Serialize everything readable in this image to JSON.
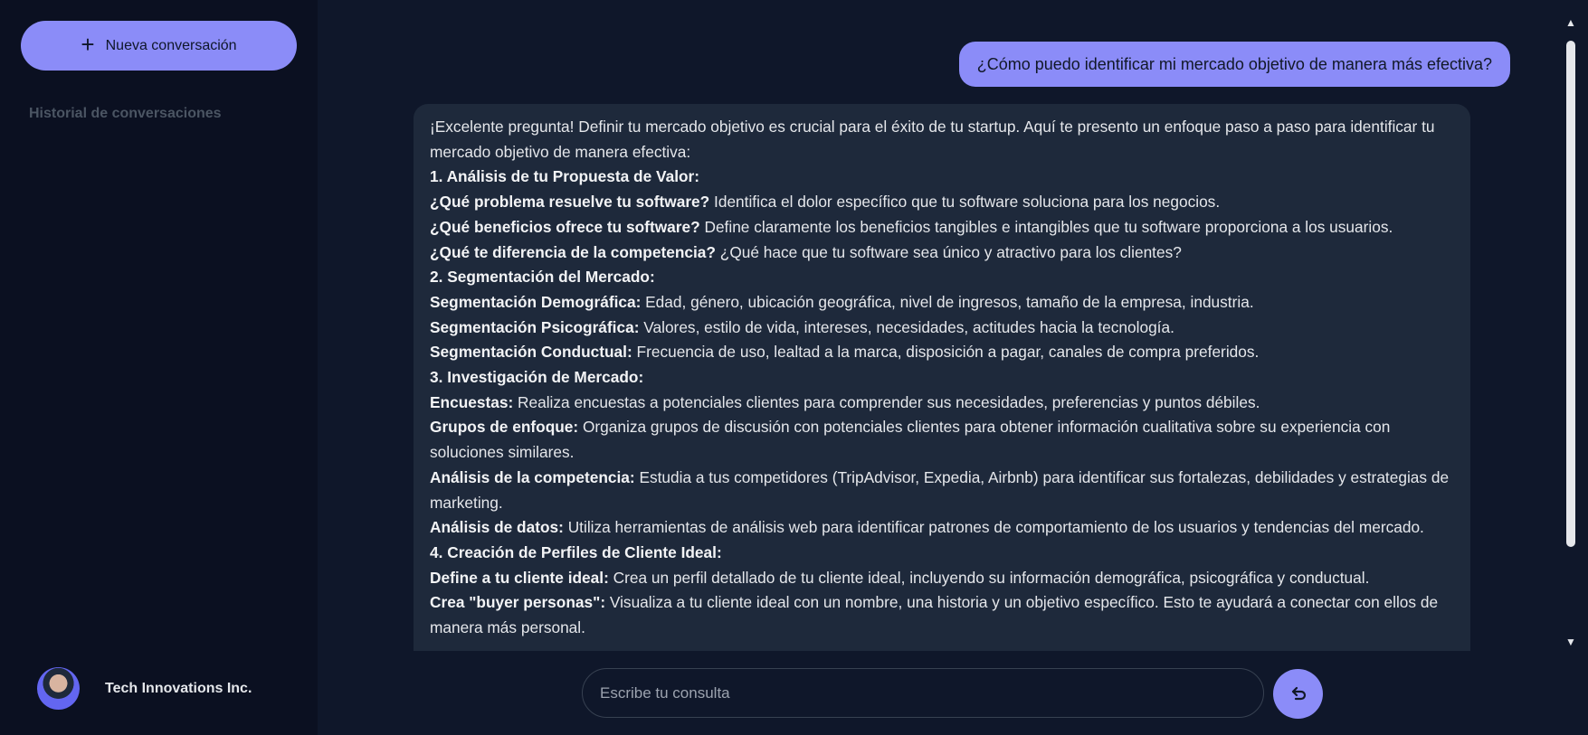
{
  "sidebar": {
    "new_chat_label": "Nueva conversación",
    "new_chat_icon": "plus-icon",
    "history_title": "Historial de conversaciones",
    "profile": {
      "name": "Tech Innovations Inc."
    }
  },
  "chat": {
    "user_message": "¿Cómo puedo identificar mi mercado objetivo de manera más efectiva?",
    "assistant_message": {
      "intro": "¡Excelente pregunta! Definir tu mercado objetivo es crucial para el éxito de tu startup. Aquí te presento un enfoque paso a paso para identificar tu mercado objetivo de manera efectiva:",
      "h1": "1. Análisis de tu Propuesta de Valor:",
      "p1_b": "¿Qué problema resuelve tu software?",
      "p1_t": " Identifica el dolor específico que tu software soluciona para los negocios.",
      "p2_b": "¿Qué beneficios ofrece tu software?",
      "p2_t": " Define claramente los beneficios tangibles e intangibles que tu software proporciona a los usuarios.",
      "p3_b": "¿Qué te diferencia de la competencia?",
      "p3_t": " ¿Qué hace que tu software sea único y atractivo para los clientes?",
      "h2": "2. Segmentación del Mercado:",
      "p4_b": "Segmentación Demográfica:",
      "p4_t": " Edad, género, ubicación geográfica, nivel de ingresos, tamaño de la empresa, industria.",
      "p5_b": "Segmentación Psicográfica:",
      "p5_t": " Valores, estilo de vida, intereses, necesidades, actitudes hacia la tecnología.",
      "p6_b": "Segmentación Conductual:",
      "p6_t": " Frecuencia de uso, lealtad a la marca, disposición a pagar, canales de compra preferidos.",
      "h3": "3. Investigación de Mercado:",
      "p7_b": "Encuestas:",
      "p7_t": " Realiza encuestas a potenciales clientes para comprender sus necesidades, preferencias y puntos débiles.",
      "p8_b": "Grupos de enfoque:",
      "p8_t": " Organiza grupos de discusión con potenciales clientes para obtener información cualitativa sobre su experiencia con soluciones similares.",
      "p9_b": "Análisis de la competencia:",
      "p9_t": " Estudia a tus competidores (TripAdvisor, Expedia, Airbnb) para identificar sus fortalezas, debilidades y estrategias de marketing.",
      "p10_b": "Análisis de datos:",
      "p10_t": " Utiliza herramientas de análisis web para identificar patrones de comportamiento de los usuarios y tendencias del mercado.",
      "h4": "4. Creación de Perfiles de Cliente Ideal:",
      "p11_b": "Define a tu cliente ideal:",
      "p11_t": " Crea un perfil detallado de tu cliente ideal, incluyendo su información demográfica, psicográfica y conductual.",
      "p12_b": "Crea \"buyer personas\":",
      "p12_t": " Visualiza a tu cliente ideal con un nombre, una historia y un objetivo específico. Esto te ayudará a conectar con ellos de manera más personal."
    }
  },
  "input": {
    "placeholder": "Escribe tu consulta",
    "value": ""
  },
  "send_icon": "send-arrow-icon",
  "colors": {
    "accent": "#8b8cf8",
    "background": "#0f172a",
    "sidebar": "#0b1021",
    "bubble": "#1e293b"
  }
}
